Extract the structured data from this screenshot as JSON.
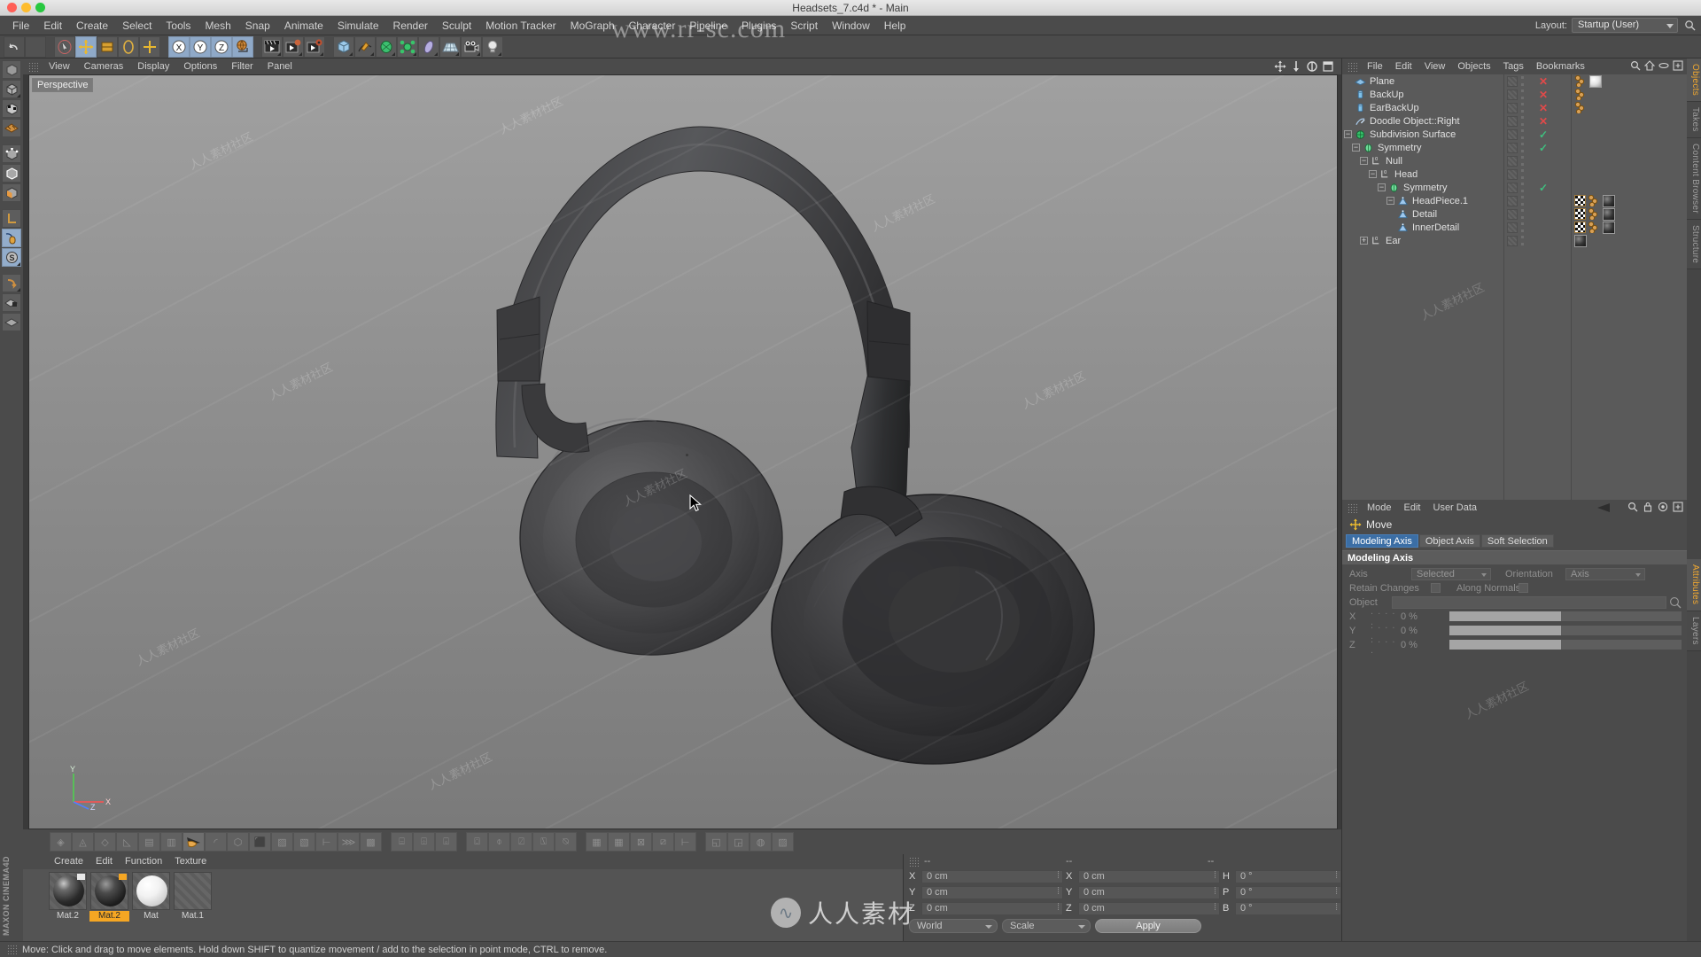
{
  "window": {
    "title": "Headsets_7.c4d * - Main"
  },
  "menubar": {
    "items": [
      "File",
      "Edit",
      "Create",
      "Select",
      "Tools",
      "Mesh",
      "Snap",
      "Animate",
      "Simulate",
      "Render",
      "Sculpt",
      "Motion Tracker",
      "MoGraph",
      "Character",
      "Pipeline",
      "Plugins",
      "Script",
      "Window",
      "Help"
    ],
    "layout_label": "Layout:",
    "layout_value": "Startup (User)",
    "search_icon": "magnifier-icon"
  },
  "toolbar": {
    "groups": [
      {
        "buttons": [
          {
            "name": "undo-button",
            "icon": "undo-arrow-icon",
            "active": false
          },
          {
            "name": "redo-button",
            "icon": "redo-arrow-icon",
            "active": false
          }
        ]
      },
      {
        "buttons": [
          {
            "name": "live-selection-button",
            "icon": "selection-cursor-icon",
            "active": false
          },
          {
            "name": "move-tool-button",
            "icon": "move-axis-icon",
            "active": true
          },
          {
            "name": "scale-tool-button",
            "icon": "scale-box-icon",
            "active": false
          },
          {
            "name": "rotate-tool-button",
            "icon": "rotate-circle-icon",
            "active": false
          },
          {
            "name": "axis-tool-button",
            "icon": "axis-cross-icon",
            "active": false
          }
        ]
      },
      {
        "buttons": [
          {
            "name": "lock-x-axis-button",
            "icon": "x-axis-icon",
            "active": true
          },
          {
            "name": "lock-y-axis-button",
            "icon": "y-axis-icon",
            "active": true
          },
          {
            "name": "lock-z-axis-button",
            "icon": "z-axis-icon",
            "active": true
          },
          {
            "name": "world-coordinate-button",
            "icon": "globe-axis-icon",
            "active": false
          }
        ]
      },
      {
        "buttons": [
          {
            "name": "render-view-button",
            "icon": "clapper-icon",
            "active": false
          },
          {
            "name": "render-region-button",
            "icon": "clapper-head-icon",
            "active": false
          },
          {
            "name": "render-settings-button",
            "icon": "clapper-gear-icon",
            "active": false
          }
        ]
      },
      {
        "buttons": [
          {
            "name": "add-cube-button",
            "icon": "cube-icon",
            "active": false
          },
          {
            "name": "add-spline-button",
            "icon": "pen-spline-icon",
            "active": false
          },
          {
            "name": "add-nurbs-button",
            "icon": "green-nurbs-icon",
            "active": false
          },
          {
            "name": "add-modeling-object-button",
            "icon": "green-array-icon",
            "active": false
          },
          {
            "name": "add-deformer-button",
            "icon": "bend-deformer-icon",
            "active": false
          },
          {
            "name": "add-environment-button",
            "icon": "floor-grid-icon",
            "active": false
          },
          {
            "name": "add-camera-button",
            "icon": "camera-icon",
            "active": false
          },
          {
            "name": "add-light-button",
            "icon": "light-bulb-icon",
            "active": false
          }
        ]
      }
    ]
  },
  "left_toolbar": {
    "buttons": [
      {
        "name": "point-mode-button",
        "icon": "point-mode-icon"
      },
      {
        "name": "model-mode-button",
        "icon": "model-cube-icon"
      },
      {
        "name": "texture-mode-button",
        "icon": "texture-checker-cube-icon"
      },
      {
        "name": "texture-axis-button",
        "icon": "texture-plane-icon"
      },
      {
        "name": "points-tool-button",
        "icon": "points-cube-icon"
      },
      {
        "name": "edges-tool-button",
        "icon": "edges-cube-icon"
      },
      {
        "name": "polygons-tool-button",
        "icon": "polygons-cube-icon"
      },
      {
        "name": "object-axis-button",
        "icon": "L-axis-icon"
      },
      {
        "name": "enable-axis-button",
        "icon": "mouse-axis-icon"
      },
      {
        "name": "snap-button",
        "icon": "snap-s-icon"
      },
      {
        "name": "workplane-button",
        "icon": "workplane-arrow-icon"
      },
      {
        "name": "lock-workplane-button",
        "icon": "workplane-lock-icon"
      },
      {
        "name": "planar-workplane-button",
        "icon": "workplane-grid-icon"
      }
    ],
    "brand": "MAXON CINEMA4D"
  },
  "viewport": {
    "menu": [
      "View",
      "Cameras",
      "Display",
      "Options",
      "Filter",
      "Panel"
    ],
    "label": "Perspective",
    "nav_icons": [
      "move-camera-icon",
      "dolly-camera-icon",
      "orbit-camera-icon",
      "maximize-viewport-icon"
    ],
    "axis_labels": {
      "x": "X",
      "y": "Y",
      "z": "Z"
    },
    "scene_object": "over-ear headphones 3D model"
  },
  "anim_toolbar": {
    "groups": [
      {
        "buttons": [
          {
            "name": "brush-tool-button",
            "icon": "sculpt-brush-icon",
            "active": false
          },
          {
            "name": "pull-tool-button",
            "icon": "sculpt-pull-icon",
            "active": false
          },
          {
            "name": "smooth-tool-button",
            "icon": "sculpt-smooth-icon",
            "active": false
          },
          {
            "name": "flatten-tool-button",
            "icon": "sculpt-flatten-icon",
            "active": false
          },
          {
            "name": "wax-tool-button",
            "icon": "sculpt-wax-icon",
            "active": false
          },
          {
            "name": "scrape-tool-button",
            "icon": "sculpt-scrape-icon",
            "active": false
          },
          {
            "name": "knife-tool-button",
            "icon": "knife-hand-icon",
            "active": true
          },
          {
            "name": "pinch-tool-button",
            "icon": "pinch-icon",
            "active": false
          },
          {
            "name": "mask-tool-button",
            "icon": "mask-shield-icon",
            "active": false
          },
          {
            "name": "inflate-tool-button",
            "icon": "inflate-cube-icon",
            "active": false
          },
          {
            "name": "fill-tool-button",
            "icon": "fill-icon",
            "active": false
          },
          {
            "name": "subdivide-button",
            "icon": "subdivide-icon",
            "active": false
          },
          {
            "name": "mirror-button",
            "icon": "mirror-icon",
            "active": false
          },
          {
            "name": "smooth-subdiv-button",
            "icon": "smooth-subdiv-icon",
            "active": false
          },
          {
            "name": "stamp-button",
            "icon": "stamp-grid-icon",
            "active": false
          }
        ]
      },
      {
        "buttons": [
          {
            "name": "bridge-button",
            "icon": "bridge-icon",
            "active": false
          },
          {
            "name": "weld-button",
            "icon": "weld-icon",
            "active": false
          },
          {
            "name": "close-hole-button",
            "icon": "close-hole-icon",
            "active": false
          }
        ]
      },
      {
        "buttons": [
          {
            "name": "extrude-button",
            "icon": "extrude-icon",
            "active": false
          },
          {
            "name": "bevel-button",
            "icon": "bevel-icon",
            "active": false
          },
          {
            "name": "slide-button",
            "icon": "slide-icon",
            "active": false
          },
          {
            "name": "knife-loop-button",
            "icon": "knife-loop-icon",
            "active": false
          },
          {
            "name": "spin-edge-button",
            "icon": "spin-edge-icon",
            "active": false
          }
        ]
      },
      {
        "buttons": [
          {
            "name": "grid-snap-button",
            "icon": "grid-snap-icon",
            "active": false
          },
          {
            "name": "point-snap-button",
            "icon": "point-snap-icon",
            "active": false
          },
          {
            "name": "axis-snap-button",
            "icon": "axis-snap-icon",
            "active": false
          },
          {
            "name": "poly-snap-button",
            "icon": "poly-snap-icon",
            "active": false
          },
          {
            "name": "guide-snap-button",
            "icon": "guide-snap-icon",
            "active": false
          }
        ]
      },
      {
        "buttons": [
          {
            "name": "uv-edit-button",
            "icon": "uv-edit-icon",
            "active": false
          },
          {
            "name": "uv-polygon-button",
            "icon": "uv-polygon-icon",
            "active": false
          },
          {
            "name": "uv-relax-button",
            "icon": "uv-relax-icon",
            "active": false
          },
          {
            "name": "uv-pattern-button",
            "icon": "uv-pattern-icon",
            "active": false
          }
        ]
      }
    ]
  },
  "object_manager": {
    "menu": [
      "File",
      "Edit",
      "View",
      "Objects",
      "Tags",
      "Bookmarks"
    ],
    "header_icons": [
      "magnifier-icon",
      "home-icon",
      "ellipse-icon",
      "add-layer-icon"
    ],
    "rows": [
      {
        "name": "Plane",
        "icon": "plane-object-icon",
        "indent": 0,
        "expander": "",
        "vis": "x",
        "tags": [
          "chain",
          "white-mat"
        ]
      },
      {
        "name": "BackUp",
        "icon": "cylinder-object-icon",
        "indent": 0,
        "expander": "",
        "vis": "x",
        "tags": [
          "chain"
        ]
      },
      {
        "name": "EarBackUp",
        "icon": "cylinder-object-icon",
        "indent": 0,
        "expander": "",
        "vis": "x",
        "tags": [
          "chain"
        ]
      },
      {
        "name": "Doodle Object::Right",
        "icon": "doodle-object-icon",
        "indent": 0,
        "expander": "",
        "vis": "x",
        "tags": []
      },
      {
        "name": "Subdivision Surface",
        "icon": "subdivision-surface-icon",
        "indent": 0,
        "expander": "-",
        "vis": "check",
        "tags": []
      },
      {
        "name": "Symmetry",
        "icon": "symmetry-object-icon",
        "indent": 1,
        "expander": "-",
        "vis": "check",
        "tags": []
      },
      {
        "name": "Null",
        "icon": "null-object-icon",
        "indent": 2,
        "expander": "-",
        "vis": "",
        "tags": []
      },
      {
        "name": "Head",
        "icon": "null-object-icon",
        "indent": 3,
        "expander": "-",
        "vis": "",
        "tags": []
      },
      {
        "name": "Symmetry",
        "icon": "symmetry-object-icon",
        "indent": 4,
        "expander": "-",
        "vis": "check",
        "tags": []
      },
      {
        "name": "HeadPiece.1",
        "icon": "polygon-object-icon",
        "indent": 5,
        "expander": "-",
        "vis": "",
        "tags": [
          "checker",
          "chain",
          "dark-mat"
        ]
      },
      {
        "name": "Detail",
        "icon": "polygon-object-icon",
        "indent": 6,
        "expander": "",
        "vis": "",
        "tags": [
          "checker",
          "chain",
          "dark-mat"
        ]
      },
      {
        "name": "InnerDetail",
        "icon": "polygon-object-icon",
        "indent": 6,
        "expander": "",
        "vis": "",
        "tags": [
          "checker",
          "chain",
          "dark-mat"
        ]
      },
      {
        "name": "Ear",
        "icon": "null-object-icon",
        "indent": 2,
        "expander": "+",
        "vis": "",
        "tags": [
          "dark-mat"
        ]
      }
    ]
  },
  "attribute_manager": {
    "menu": [
      "Mode",
      "Edit",
      "User Data"
    ],
    "header_icons": [
      "back-arrow-icon",
      "magnifier-icon",
      "lock-icon",
      "target-icon",
      "add-icon"
    ],
    "mode_label": "Move",
    "mode_icon": "move-axis-icon",
    "tabs": [
      {
        "label": "Modeling Axis",
        "active": true
      },
      {
        "label": "Object Axis",
        "active": false
      },
      {
        "label": "Soft Selection",
        "active": false
      }
    ],
    "section_title": "Modeling Axis",
    "fields": {
      "axis_label": "Axis",
      "axis_dots": ". . . . . . . . .",
      "axis_value": "Selected",
      "orientation_label": "Orientation",
      "orientation_dots": ". . .",
      "orientation_value": "Axis",
      "retain_changes_label": "Retain Changes",
      "along_normals_label": "Along Normals",
      "object_label": "Object",
      "object_value": "",
      "x_label": "X",
      "x_dots": ". . . . .",
      "x_value": "0 %",
      "y_label": "Y",
      "y_dots": ". . . . .",
      "y_value": "0 %",
      "z_label": "Z",
      "z_dots": ". . . . .",
      "z_value": "0 %"
    }
  },
  "right_tabs": {
    "top": [
      {
        "label": "Objects",
        "active": true
      },
      {
        "label": "Takes",
        "active": false
      },
      {
        "label": "Content Browser",
        "active": false
      },
      {
        "label": "Structure",
        "active": false
      }
    ],
    "bottom": [
      {
        "label": "Attributes",
        "active": true
      },
      {
        "label": "Layers",
        "active": false
      }
    ]
  },
  "material_manager": {
    "menu": [
      "Create",
      "Edit",
      "Function",
      "Texture"
    ],
    "materials": [
      {
        "name": "Mat.2",
        "preview": "dark-glossy-sphere",
        "selected": false,
        "flag": "white"
      },
      {
        "name": "Mat.2",
        "preview": "dark-matte-sphere",
        "selected": true,
        "flag": "orange"
      },
      {
        "name": "Mat",
        "preview": "white-sphere",
        "selected": false,
        "flag": "none"
      },
      {
        "name": "Mat.1",
        "preview": "empty-slot",
        "selected": false,
        "flag": "none"
      }
    ]
  },
  "coordinate_manager": {
    "header": [
      "--",
      "--",
      "--"
    ],
    "rows": [
      {
        "pos_label": "X",
        "pos_value": "0 cm",
        "size_label": "X",
        "size_value": "0 cm",
        "rot_label": "H",
        "rot_value": "0 °"
      },
      {
        "pos_label": "Y",
        "pos_value": "0 cm",
        "size_label": "Y",
        "size_value": "0 cm",
        "rot_label": "P",
        "rot_value": "0 °"
      },
      {
        "pos_label": "Z",
        "pos_value": "0 cm",
        "size_label": "Z",
        "size_value": "0 cm",
        "rot_label": "B",
        "rot_value": "0 °"
      }
    ],
    "coord_system": "World",
    "size_mode": "Scale",
    "apply_label": "Apply"
  },
  "statusbar": {
    "message": "Move: Click and drag to move elements. Hold down SHIFT to quantize movement / add to the selection in point mode, CTRL to remove."
  },
  "watermarks": {
    "url": "www.rr-sc.com",
    "logo_text": "人人素材",
    "tile_text": "人人素材社区"
  },
  "colors": {
    "accent_orange": "#f5a623",
    "tab_active_blue": "#3b6ea5",
    "tool_active_blue": "#8fa9c8",
    "panel_bg": "#4b4b4b",
    "tree_bg": "#5a5a5a",
    "viewport_bg": "#8a8a8a"
  }
}
